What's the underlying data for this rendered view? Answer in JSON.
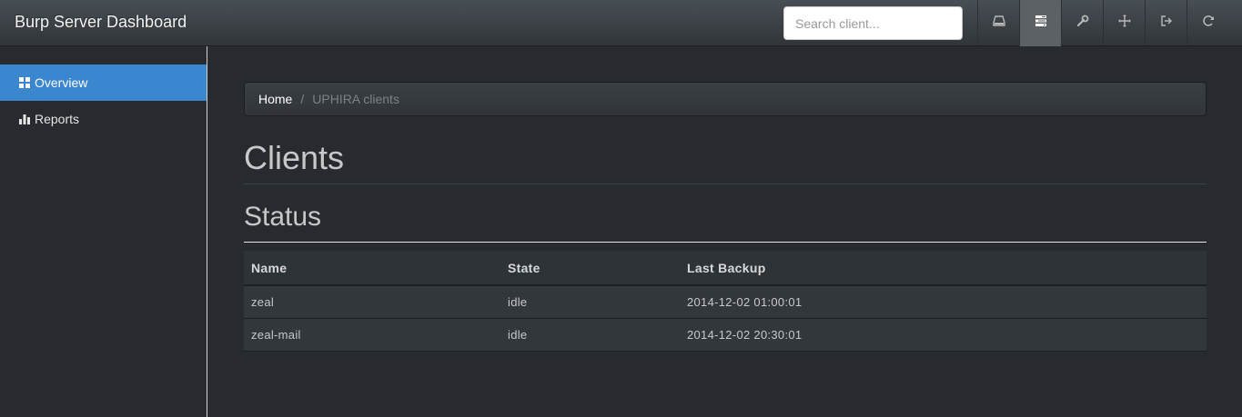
{
  "app": {
    "title": "Burp Server Dashboard"
  },
  "search": {
    "placeholder": "Search client..."
  },
  "toolbar": {
    "buttons": [
      {
        "icon": "hdd-icon"
      },
      {
        "icon": "tasks-icon",
        "active": true
      },
      {
        "icon": "wrench-icon"
      },
      {
        "icon": "move-icon"
      },
      {
        "icon": "logout-icon"
      },
      {
        "icon": "refresh-icon"
      }
    ]
  },
  "sidebar": {
    "items": [
      {
        "label": "Overview",
        "icon": "dashboard-icon",
        "active": true
      },
      {
        "label": "Reports",
        "icon": "stats-icon",
        "active": false
      }
    ]
  },
  "breadcrumb": {
    "home": "Home",
    "separator": "/",
    "current": "UPHIRA clients"
  },
  "main": {
    "title": "Clients",
    "subtitle": "Status",
    "table": {
      "headers": [
        "Name",
        "State",
        "Last Backup"
      ],
      "rows": [
        [
          "zeal",
          "idle",
          "2014-12-02 01:00:01"
        ],
        [
          "zeal-mail",
          "idle",
          "2014-12-02 20:30:01"
        ]
      ]
    }
  },
  "colors": {
    "accent": "#3a87d0",
    "background": "#272b30"
  }
}
